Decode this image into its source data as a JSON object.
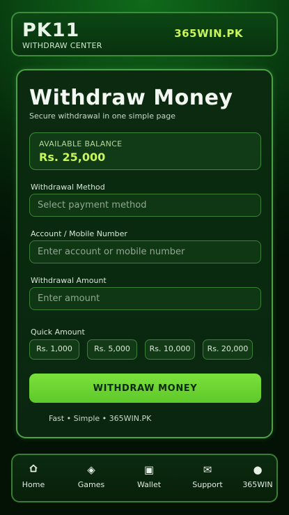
{
  "header": {
    "brand": "PK11",
    "subtitle": "WITHDRAW CENTER",
    "site": "365WIN.PK"
  },
  "card": {
    "title": "Withdraw Money",
    "subtitle": "Secure withdrawal in one simple page",
    "balance": {
      "label": "AVAILABLE BALANCE",
      "value": "Rs. 25,000"
    },
    "fields": {
      "method": {
        "label": "Withdrawal Method",
        "placeholder": "Select payment method"
      },
      "account": {
        "label": "Account / Mobile Number",
        "placeholder": "Enter account or mobile number"
      },
      "amount": {
        "label": "Withdrawal Amount",
        "placeholder": "Enter amount"
      }
    },
    "quick_amount": {
      "label": "Quick Amount",
      "options": [
        "Rs. 1,000",
        "Rs. 5,000",
        "Rs. 10,000",
        "Rs. 20,000"
      ]
    },
    "submit_label": "WITHDRAW MONEY",
    "footer_note": "Fast • Simple • 365WIN.PK"
  },
  "nav": {
    "items": [
      {
        "label": "Home",
        "icon": "home-icon"
      },
      {
        "label": "Games",
        "icon": "diamond-icon"
      },
      {
        "label": "Wallet",
        "icon": "wallet-icon"
      },
      {
        "label": "Support",
        "icon": "mail-icon"
      },
      {
        "label": "365WIN",
        "icon": "circle-icon"
      }
    ]
  },
  "colors": {
    "accent": "#c8f55a",
    "button": "#6cd632",
    "border": "#4ea147"
  }
}
